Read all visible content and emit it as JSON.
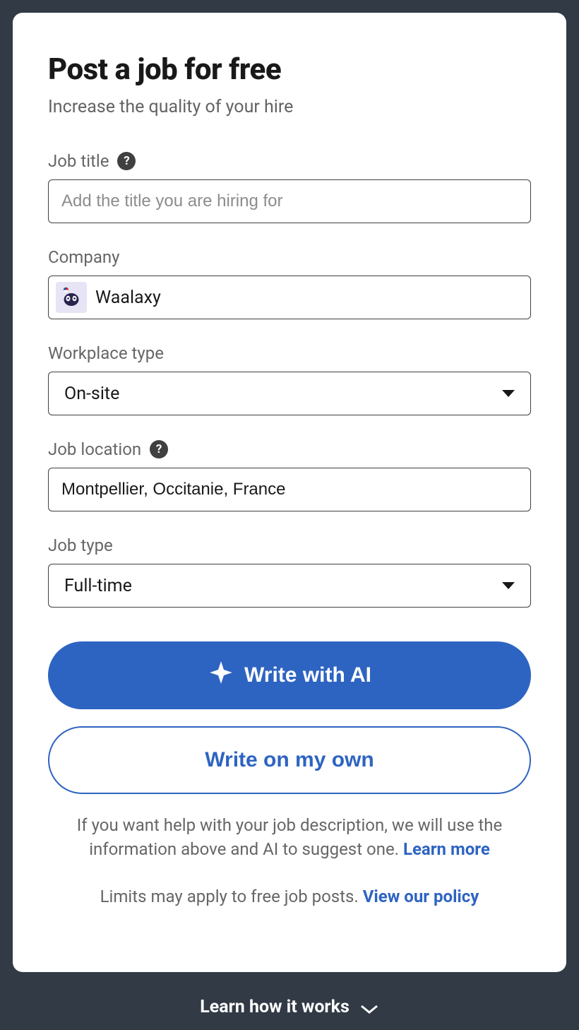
{
  "header": {
    "title": "Post a job for free",
    "subtitle": "Increase the quality of your hire"
  },
  "fields": {
    "jobTitle": {
      "label": "Job title",
      "placeholder": "Add the title you are hiring for",
      "value": ""
    },
    "company": {
      "label": "Company",
      "value": "Waalaxy"
    },
    "workplaceType": {
      "label": "Workplace type",
      "value": "On-site"
    },
    "jobLocation": {
      "label": "Job location",
      "value": "Montpellier, Occitanie, France"
    },
    "jobType": {
      "label": "Job type",
      "value": "Full-time"
    }
  },
  "buttons": {
    "writeWithAI": "Write with AI",
    "writeOnMyOwn": "Write on my own"
  },
  "helpText": {
    "description": "If you want help with your job description, we will use the information above and AI to suggest one. ",
    "learnMore": "Learn more"
  },
  "policyText": {
    "description": "Limits may apply to free job posts. ",
    "link": "View our policy"
  },
  "footer": {
    "text": "Learn how it works"
  }
}
